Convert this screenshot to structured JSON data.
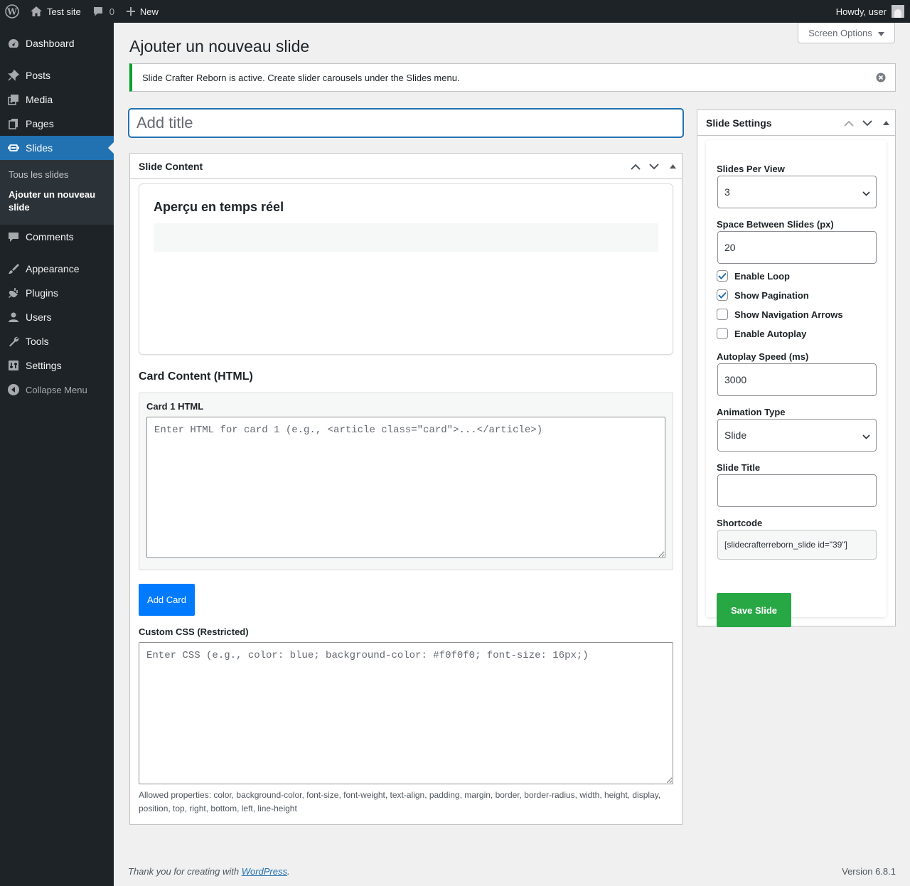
{
  "adminbar": {
    "site_name": "Test site",
    "comments_count": "0",
    "new_label": "New",
    "howdy": "Howdy, user"
  },
  "sidebar": {
    "items": [
      {
        "label": "Dashboard",
        "icon": "dashboard-icon"
      },
      {
        "label": "Posts",
        "icon": "pin-icon"
      },
      {
        "label": "Media",
        "icon": "media-icon"
      },
      {
        "label": "Pages",
        "icon": "pages-icon"
      },
      {
        "label": "Slides",
        "icon": "slides-icon"
      },
      {
        "label": "Comments",
        "icon": "comments-icon"
      },
      {
        "label": "Appearance",
        "icon": "brush-icon"
      },
      {
        "label": "Plugins",
        "icon": "plugin-icon"
      },
      {
        "label": "Users",
        "icon": "users-icon"
      },
      {
        "label": "Tools",
        "icon": "wrench-icon"
      },
      {
        "label": "Settings",
        "icon": "settings-icon"
      }
    ],
    "submenu": [
      "Tous les slides",
      "Ajouter un nouveau slide"
    ],
    "collapse_label": "Collapse Menu"
  },
  "screen_options": "Screen Options",
  "page_title": "Ajouter un nouveau slide",
  "notice": "Slide Crafter Reborn is active. Create slider carousels under the Slides menu.",
  "title_placeholder": "Add title",
  "slide_content": {
    "header": "Slide Content",
    "preview_title": "Aperçu en temps réel",
    "card_section_title": "Card Content (HTML)",
    "card1_label": "Card 1 HTML",
    "card1_placeholder": "Enter HTML for card 1 (e.g., <article class=\"card\">...</article>)",
    "add_card_label": "Add Card",
    "css_label": "Custom CSS (Restricted)",
    "css_placeholder": "Enter CSS (e.g., color: blue; background-color: #f0f0f0; font-size: 16px;)",
    "css_help": "Allowed properties: color, background-color, font-size, font-weight, text-align, padding, margin, border, border-radius, width, height, display, position, top, right, bottom, left, line-height"
  },
  "slide_settings": {
    "header": "Slide Settings",
    "slides_per_view_label": "Slides Per View",
    "slides_per_view_value": "3",
    "space_between_label": "Space Between Slides (px)",
    "space_between_value": "20",
    "checks": [
      {
        "label": "Enable Loop",
        "checked": true
      },
      {
        "label": "Show Pagination",
        "checked": true
      },
      {
        "label": "Show Navigation Arrows",
        "checked": false
      },
      {
        "label": "Enable Autoplay",
        "checked": false
      }
    ],
    "autoplay_speed_label": "Autoplay Speed (ms)",
    "autoplay_speed_value": "3000",
    "animation_type_label": "Animation Type",
    "animation_type_value": "Slide",
    "slide_title_label": "Slide Title",
    "slide_title_value": "",
    "shortcode_label": "Shortcode",
    "shortcode_value": "[slidecrafterreborn_slide id=\"39\"]",
    "save_label": "Save Slide"
  },
  "footer": {
    "thanks_prefix": "Thank you for creating with ",
    "thanks_link": "WordPress",
    "thanks_suffix": ".",
    "version": "Version 6.8.1"
  },
  "colors": {
    "admin_dark": "#1d2327",
    "accent_blue": "#2271b1",
    "notice_green": "#00a32a",
    "add_card_blue": "#007bff",
    "save_green": "#28a745"
  }
}
